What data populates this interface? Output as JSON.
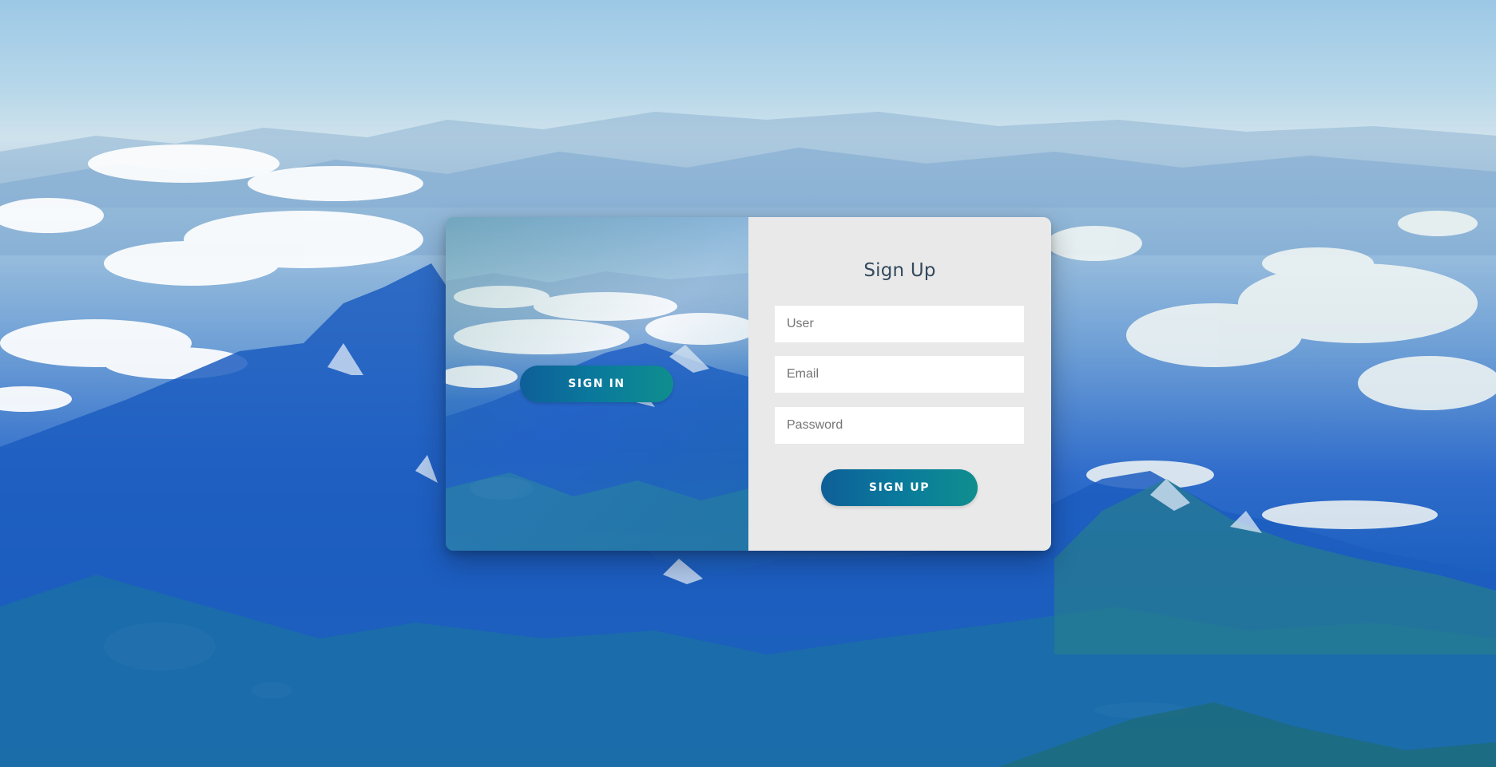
{
  "form": {
    "title": "Sign Up",
    "user_placeholder": "User",
    "email_placeholder": "Email",
    "password_placeholder": "Password",
    "submit_label": "SIGN UP"
  },
  "overlay": {
    "signin_label": "SIGN IN"
  },
  "colors": {
    "button_gradient_start": "#0e5f98",
    "button_gradient_end": "#0f8e8e",
    "form_background": "#e9e9e9",
    "title_color": "#34495e"
  }
}
